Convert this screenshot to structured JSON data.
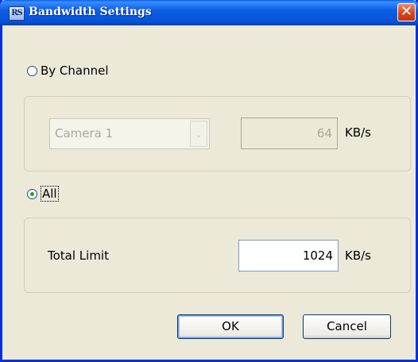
{
  "window": {
    "title": "Bandwidth Settings",
    "icon_text": "RS",
    "close_glyph": "✕"
  },
  "by_channel": {
    "radio_label": "By Channel",
    "selected": false,
    "camera_select": {
      "value": "Camera 1",
      "arrow": "⌄"
    },
    "limit_value": "64",
    "unit": "KB/s"
  },
  "all": {
    "radio_label": "All",
    "selected": true,
    "total_limit_label": "Total Limit",
    "total_limit_value": "1024",
    "unit": "KB/s"
  },
  "buttons": {
    "ok": "OK",
    "cancel": "Cancel"
  }
}
